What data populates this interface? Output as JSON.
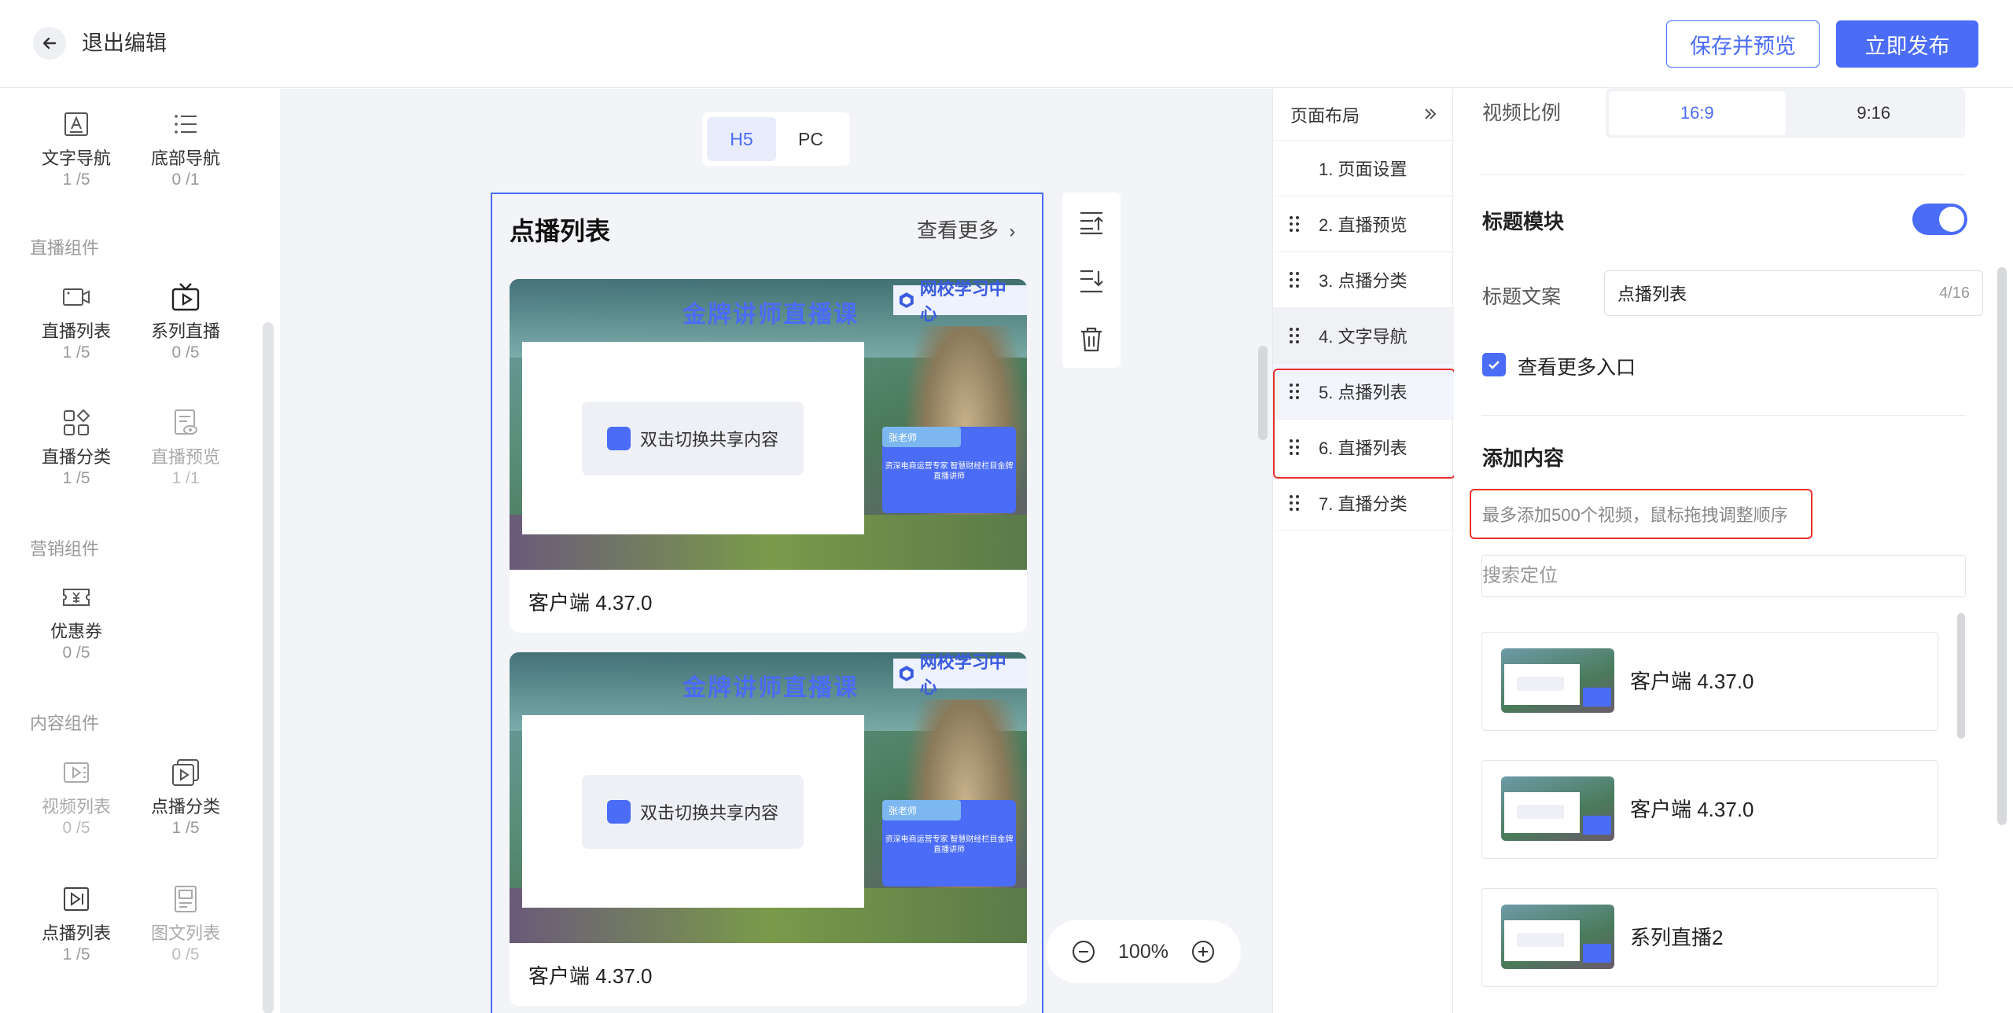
{
  "header": {
    "back_label": "退出编辑",
    "save_preview_label": "保存并预览",
    "publish_label": "立即发布"
  },
  "left_panel": {
    "components_top": [
      {
        "name": "文字导航",
        "count": "1 /5",
        "icon": "text-nav-icon"
      },
      {
        "name": "底部导航",
        "count": "0 /1",
        "icon": "list-icon"
      }
    ],
    "group_live": "直播组件",
    "live_components": [
      {
        "name": "直播列表",
        "count": "1 /5",
        "icon": "video-camera-icon"
      },
      {
        "name": "系列直播",
        "count": "0 /5",
        "icon": "tv-play-icon"
      },
      {
        "name": "直播分类",
        "count": "1 /5",
        "icon": "category-grid-icon"
      },
      {
        "name": "直播预览",
        "count": "1 /1",
        "icon": "doc-eye-icon"
      }
    ],
    "group_marketing": "营销组件",
    "marketing_components": [
      {
        "name": "优惠券",
        "count": "0 /5",
        "icon": "coupon-icon"
      }
    ],
    "group_content": "内容组件",
    "content_components": [
      {
        "name": "视频列表",
        "count": "0 /5",
        "icon": "video-list-icon"
      },
      {
        "name": "点播分类",
        "count": "1 /5",
        "icon": "vod-category-icon"
      },
      {
        "name": "点播列表",
        "count": "1 /5",
        "icon": "vod-list-icon"
      },
      {
        "name": "图文列表",
        "count": "0 /5",
        "icon": "article-list-icon"
      }
    ]
  },
  "canvas": {
    "tabs": [
      "H5",
      "PC"
    ],
    "active_tab": "H5",
    "module_title": "点播列表",
    "more_label": "查看更多",
    "cards": [
      {
        "caption": "客户端 4.37.0",
        "thumb_title": "金牌讲师直播课",
        "thumb_brand": "网校学习中心",
        "switch_text": "双击切换共享内容",
        "teacher": "张老师",
        "teacher_desc": "资深电商运营专家 智慧财经栏目金牌直播讲师"
      },
      {
        "caption": "客户端 4.37.0",
        "thumb_title": "金牌讲师直播课",
        "thumb_brand": "网校学习中心",
        "switch_text": "双击切换共享内容",
        "teacher": "张老师",
        "teacher_desc": "资深电商运营专家 智慧财经栏目金牌直播讲师"
      }
    ],
    "zoom_level": "100%"
  },
  "layout_panel": {
    "title": "页面布局",
    "items": [
      {
        "label": "1. 页面设置"
      },
      {
        "label": "2. 直播预览"
      },
      {
        "label": "3. 点播分类"
      },
      {
        "label": "4. 文字导航"
      },
      {
        "label": "5. 点播列表"
      },
      {
        "label": "6. 直播列表"
      },
      {
        "label": "7. 直播分类"
      }
    ]
  },
  "settings": {
    "ratio_label": "视频比例",
    "ratio_options": [
      "16:9",
      "9:16"
    ],
    "ratio_selected": "16:9",
    "title_module_label": "标题模块",
    "title_module_enabled": true,
    "title_text_label": "标题文案",
    "title_text_value": "点播列表",
    "title_text_count": "4/16",
    "more_entry_label": "查看更多入口",
    "more_entry_checked": true,
    "add_content_label": "添加内容",
    "add_content_hint": "最多添加500个视频，鼠标拖拽调整顺序",
    "search_placeholder": "搜索定位",
    "videos": [
      {
        "name": "客户端 4.37.0"
      },
      {
        "name": "客户端 4.37.0"
      },
      {
        "name": "系列直播2"
      }
    ]
  },
  "colors": {
    "accent": "#4a6cf7",
    "highlight_border": "#e8302a",
    "canvas_bg": "#f3f4f7"
  }
}
